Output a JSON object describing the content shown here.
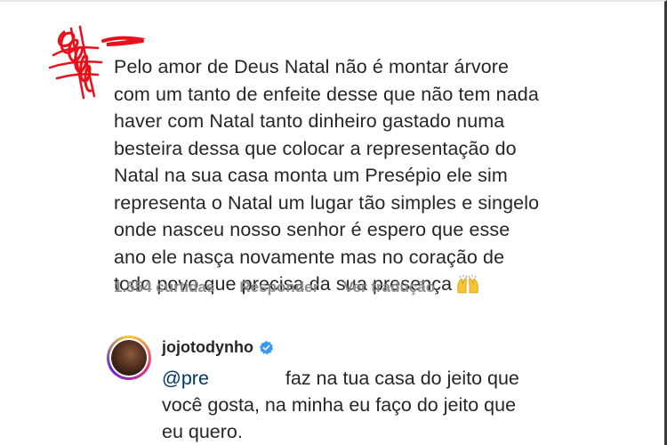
{
  "comment": {
    "lines": [
      "Pelo amor de Deus Natal não é montar árvore",
      "com um tanto de enfeite desse que não tem nada",
      "haver com Natal tanto dinheiro gastado numa",
      "besteira dessa que colocar a representação do",
      "Natal na sua casa monta um Presépio ele sim",
      "representa o Natal um lugar tão simples e singelo",
      "onde nasceu nosso senhor é espero que esse",
      "ano ele nasça novamente mas no coração de",
      "todo povo que precisa da sua presença"
    ],
    "emoji_icon": "raising-hands-icon",
    "likes": "1.554 curtidas",
    "reply_label": "Responder",
    "translate_label": "Ver tradução",
    "redaction_color": "#e8101a"
  },
  "reply": {
    "username": "jojotodynho",
    "verified_icon": "verified-badge-icon",
    "verified_color": "#3897f0",
    "mention": "@pre",
    "line1_rest": "faz na tua casa do jeito que",
    "line2": "você gosta, na minha eu faço do jeito que",
    "line3": "eu quero."
  }
}
